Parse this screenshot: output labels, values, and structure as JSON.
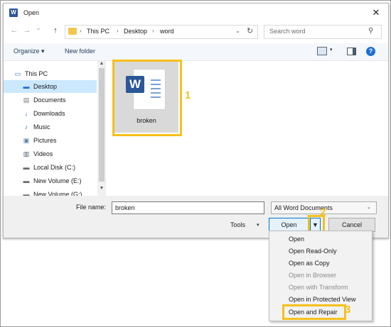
{
  "window": {
    "title": "Open",
    "app_icon_letter": "W",
    "close_glyph": "✕"
  },
  "nav": {
    "back_glyph": "←",
    "forward_glyph": "→",
    "recent_glyph": "⌄",
    "up_glyph": "↑"
  },
  "address": {
    "crumbs": [
      "This PC",
      "Desktop",
      "word"
    ],
    "separator": "›",
    "dropdown_glyph": "⌄",
    "refresh_glyph": "↻"
  },
  "search": {
    "placeholder": "Search word",
    "icon_glyph": "⚲"
  },
  "toolbar": {
    "organize_label": "Organize",
    "organize_arrow": "▾",
    "new_folder_label": "New folder",
    "view_arrow": "▾",
    "help_glyph": "?"
  },
  "sidebar": {
    "items": [
      {
        "label": "This PC",
        "icon": "computer-icon"
      },
      {
        "label": "Desktop",
        "icon": "desktop-icon",
        "selected": true
      },
      {
        "label": "Documents",
        "icon": "documents-icon"
      },
      {
        "label": "Downloads",
        "icon": "downloads-icon"
      },
      {
        "label": "Music",
        "icon": "music-icon"
      },
      {
        "label": "Pictures",
        "icon": "pictures-icon"
      },
      {
        "label": "Videos",
        "icon": "videos-icon"
      },
      {
        "label": "Local Disk (C:)",
        "icon": "drive-icon"
      },
      {
        "label": "New Volume (E:)",
        "icon": "drive-icon"
      },
      {
        "label": "New Volume (G:)",
        "icon": "drive-icon"
      }
    ],
    "scroll_up": "▲",
    "scroll_down": "▼"
  },
  "files": [
    {
      "name": "broken",
      "type": "word-document",
      "badge": "W"
    }
  ],
  "callouts": {
    "one": "1",
    "two": "2",
    "three": "3"
  },
  "footer": {
    "filename_label": "File name:",
    "filename_value": "broken",
    "filetype_value": "All Word Documents",
    "filetype_arrow": "⌄",
    "tools_label": "Tools",
    "tools_arrow": "▾",
    "open_label": "Open",
    "open_dropdown_arrow": "▼",
    "cancel_label": "Cancel"
  },
  "open_menu": {
    "items": [
      {
        "label": "Open",
        "enabled": true
      },
      {
        "label": "Open Read-Only",
        "enabled": true
      },
      {
        "label": "Open as Copy",
        "enabled": true
      },
      {
        "label": "Open in Browser",
        "enabled": false
      },
      {
        "label": "Open with Transform",
        "enabled": false
      },
      {
        "label": "Open in Protected View",
        "enabled": true
      },
      {
        "label": "Open and Repair",
        "enabled": true
      }
    ]
  },
  "colors": {
    "accent": "#0078d7",
    "highlight": "#f5c11b",
    "selection": "#cce8ff",
    "word_blue": "#2b5797"
  }
}
